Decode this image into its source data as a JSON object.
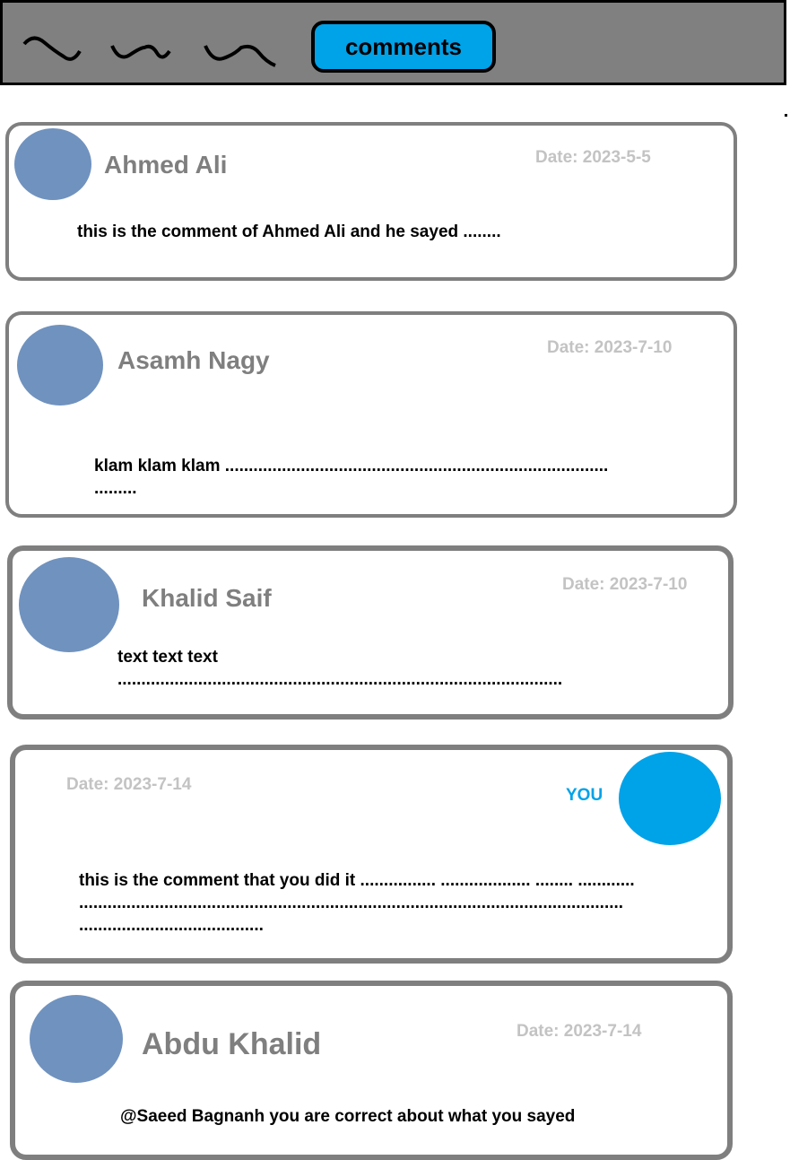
{
  "header": {
    "tab_icons": [
      "squiggle-icon",
      "squiggle-icon",
      "squiggle-icon"
    ],
    "comments_button_label": "comments",
    "accent_color": "#00a2e8",
    "bar_color": "#808080"
  },
  "comments": [
    {
      "author": "Ahmed Ali",
      "date": "Date: 2023-5-5",
      "text": "this is the comment of Ahmed Ali and he sayed ........"
    },
    {
      "author": "Asamh Nagy",
      "date": "Date: 2023-7-10",
      "text": "klam klam klam .................................................................................\n........."
    },
    {
      "author": "Khalid Saif",
      "date": "Date: 2023-7-10",
      "text": "text text text\n.............................................................................................."
    },
    {
      "author": "",
      "you_label": "YOU",
      "date": "Date: 2023-7-14",
      "text": "this is the comment that you did it ................ ................... ........ ............\n...................................................................................................................\n......................................."
    },
    {
      "author": "Abdu Khalid",
      "date": "Date: 2023-7-14",
      "text": "@Saeed Bagnanh you are correct about what you sayed"
    }
  ]
}
